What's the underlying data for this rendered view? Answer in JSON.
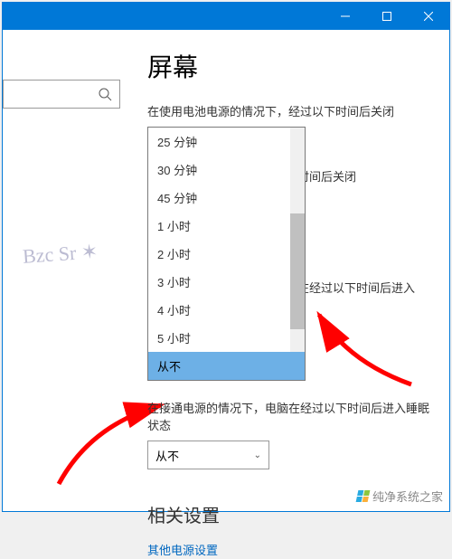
{
  "titlebar": {
    "minimize": "—",
    "maximize": "□",
    "close": "✕"
  },
  "sidebar": {
    "search_placeholder": ""
  },
  "page": {
    "title": "屏幕",
    "battery_off_label": "在使用电池电源的情况下，经过以下时间后关闭",
    "plugged_off_label_right": "以下时间后关闭",
    "battery_sleep_label_right": "电脑在经过以下时间后进入",
    "plugged_sleep_label": "在接通电源的情况下，电脑在经过以下时间后进入睡眠状态",
    "plugged_sleep_value": "从不",
    "related_title": "相关设置",
    "related_link": "其他电源设置"
  },
  "dropdown": {
    "items": [
      "25 分钟",
      "30 分钟",
      "45 分钟",
      "1 小时",
      "2 小时",
      "3 小时",
      "4 小时",
      "5 小时",
      "从不"
    ],
    "selected_index": 8
  },
  "watermark": {
    "text": "纯净系统之家",
    "url": "ycwjxz.com"
  }
}
